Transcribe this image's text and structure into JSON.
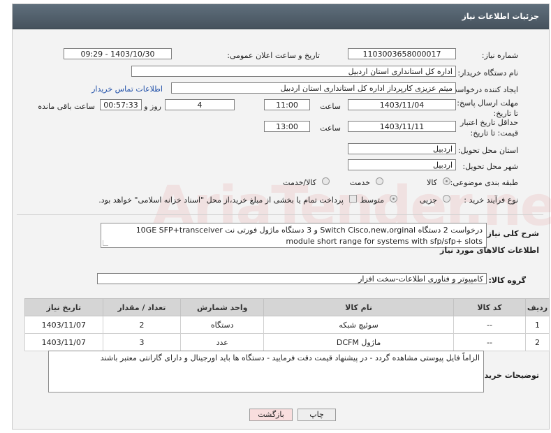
{
  "header": {
    "title": "جزئیات اطلاعات نیاز"
  },
  "form": {
    "need_number_label": "شماره نیاز:",
    "need_number": "1103003658000017",
    "announce_label": "تاریخ و ساعت اعلان عمومی:",
    "announce_value": "1403/10/30 - 09:29",
    "buyer_org_label": "نام دستگاه خریدار:",
    "buyer_org": "اداره کل استانداری استان اردبیل",
    "creator_label": "ایجاد کننده درخواست:",
    "creator": "میثم عزیزی کارپرداز اداره کل استانداری استان اردبیل",
    "contact_link": "اطلاعات تماس خریدار",
    "send_deadline_label": "مهلت ارسال پاسخ: تا تاریخ:",
    "send_deadline_date": "1403/11/04",
    "time_label": "ساعت",
    "send_deadline_time": "11:00",
    "days_value": "4",
    "days_label": "روز و",
    "remaining_value": "00:57:33",
    "remaining_label": "ساعت باقی مانده",
    "min_validity_label": "حداقل تاریخ اعتبار قیمت: تا تاریخ:",
    "min_validity_date": "1403/11/11",
    "min_validity_time": "13:00",
    "province_label": "استان محل تحویل:",
    "province": "اردبیل",
    "city_label": "شهر محل تحویل:",
    "city": "اردبیل",
    "category_label": "طبقه بندی موضوعی:",
    "category_options": [
      "کالا",
      "خدمت",
      "کالا/خدمت"
    ],
    "process_label": "نوع فرآیند خرید :",
    "process_options": [
      "جزیی",
      "متوسط"
    ],
    "payment_note": "پرداخت تمام یا بخشی از مبلغ خرید،از محل \"اسناد خزانه اسلامی\" خواهد بود."
  },
  "description": {
    "label": "شرح کلی نیاز:",
    "text": "درخواست 2 دستگاه Switch Cisco,new,orginal و 3 دستگاه ماژول فورتی نت 10GE SFP+transceiver module short range for systems with sfp/sfp+ slots"
  },
  "goods_section": {
    "title": "اطلاعات کالاهای مورد نیاز",
    "group_label": "گروه کالا:",
    "group_value": "کامپیوتر و فناوری اطلاعات-سخت افزار"
  },
  "table": {
    "headers": [
      "ردیف",
      "کد کالا",
      "نام کالا",
      "واحد شمارش",
      "تعداد / مقدار",
      "تاریخ نیاز"
    ],
    "rows": [
      [
        "1",
        "--",
        "سوئیچ شبکه",
        "دستگاه",
        "2",
        "1403/11/07"
      ],
      [
        "2",
        "--",
        "ماژول DCFM",
        "عدد",
        "3",
        "1403/11/07"
      ]
    ]
  },
  "buyer_notes": {
    "label": "توضیحات خریدار:",
    "text": "الزاماً فایل پیوستی مشاهده گردد - در پیشنهاد قیمت دقت فرمایید - دستگاه ها باید اورجینال و دارای گارانتی معتبر باشند"
  },
  "buttons": {
    "print": "چاپ",
    "back": "بازگشت"
  },
  "watermark": "AriaTender.neT",
  "colors": {
    "header": "#4f5c68",
    "link": "#1f4fa8",
    "back_button": "#f9dede"
  }
}
